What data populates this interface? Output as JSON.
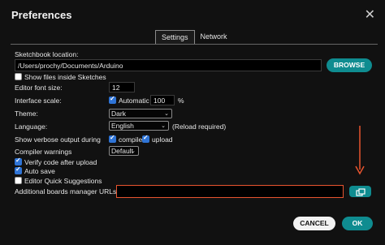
{
  "window": {
    "title": "Preferences",
    "close_icon": "close-icon"
  },
  "tabs": [
    {
      "label": "Settings",
      "active": true
    },
    {
      "label": "Network",
      "active": false
    }
  ],
  "sketchbook": {
    "label": "Sketchbook location:",
    "value": "/Users/prochy/Documents/Arduino",
    "browse_label": "BROWSE",
    "show_files_label": "Show files inside Sketches",
    "show_files_checked": false
  },
  "font_size": {
    "label": "Editor font size:",
    "value": "12"
  },
  "interface_scale": {
    "label": "Interface scale:",
    "automatic_label": "Automatic",
    "automatic_checked": true,
    "value": "100",
    "unit": "%"
  },
  "theme": {
    "label": "Theme:",
    "value": "Dark"
  },
  "language": {
    "label": "Language:",
    "value": "English",
    "note": "(Reload required)"
  },
  "verbose": {
    "label": "Show verbose output during",
    "compile_label": "compile",
    "compile_checked": true,
    "upload_label": "upload",
    "upload_checked": true
  },
  "compiler_warnings": {
    "label": "Compiler warnings",
    "value": "Default"
  },
  "checkboxes": {
    "verify_label": "Verify code after upload",
    "verify_checked": true,
    "autosave_label": "Auto save",
    "autosave_checked": true,
    "quick_suggestions_label": "Editor Quick Suggestions",
    "quick_suggestions_checked": false
  },
  "boards_manager": {
    "label": "Additional boards manager URLs:",
    "value": "",
    "icon": "open-window-icon"
  },
  "footer": {
    "cancel_label": "CANCEL",
    "ok_label": "OK"
  },
  "colors": {
    "accent": "#0f8c90",
    "highlight": "#e8542f",
    "checkbox": "#2f74d6"
  }
}
